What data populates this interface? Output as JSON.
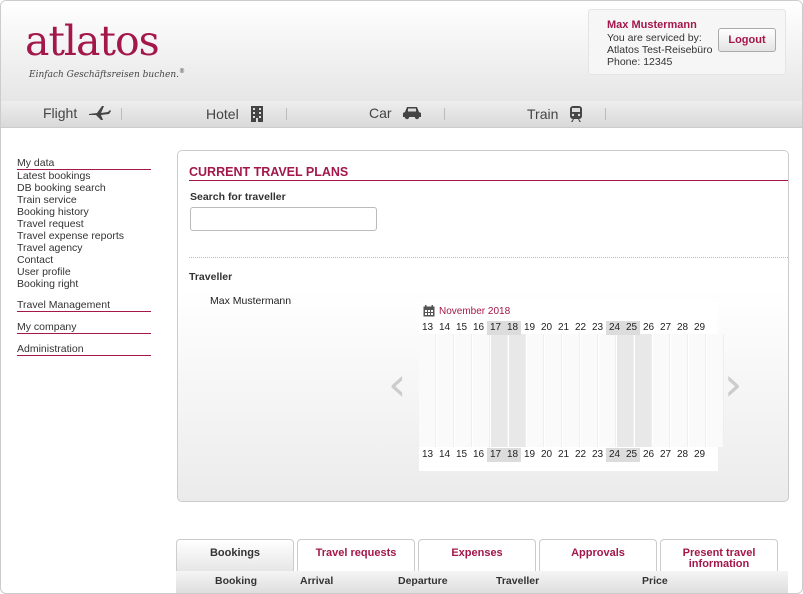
{
  "brand": {
    "name": "atlatos",
    "tagline": "Einfach Geschäftsreisen buchen.",
    "reg": "®",
    "color": "#a3174a"
  },
  "user": {
    "name": "Max Mustermann",
    "serviced": "You are serviced by:",
    "agency": "Atlatos Test-Reisebüro",
    "phone": "Phone: 12345",
    "logout_label": "Logout"
  },
  "nav": [
    {
      "label": "Flight",
      "icon": "plane-icon"
    },
    {
      "label": "Hotel",
      "icon": "hotel-building-icon"
    },
    {
      "label": "Car",
      "icon": "car-icon"
    },
    {
      "label": "Train",
      "icon": "train-icon"
    }
  ],
  "sidebar": {
    "mydata": "My data",
    "items": [
      "Latest bookings",
      "DB booking search",
      "Train service",
      "Booking history",
      "Travel request",
      "Travel expense reports",
      "Travel agency",
      "Contact",
      "User profile",
      "Booking right"
    ],
    "travel_mgmt": "Travel Management",
    "company": "My company",
    "admin": "Administration"
  },
  "panel": {
    "title": "CURRENT TRAVEL PLANS",
    "search_label": "Search for traveller",
    "traveller_label": "Traveller",
    "traveller_name": "Max Mustermann"
  },
  "calendar": {
    "month": "November 2018",
    "days": [
      "13",
      "14",
      "15",
      "16",
      "17",
      "18",
      "19",
      "20",
      "21",
      "22",
      "23",
      "24",
      "25",
      "26",
      "27",
      "28",
      "29"
    ],
    "weekend_indices": [
      4,
      5,
      11,
      12
    ],
    "icon": "calendar-icon"
  },
  "tabs": [
    "Bookings",
    "Travel requests",
    "Expenses",
    "Approvals",
    "Present travel information"
  ],
  "table_headers": [
    "Booking",
    "Arrival",
    "Departure",
    "Traveller",
    "Price"
  ]
}
